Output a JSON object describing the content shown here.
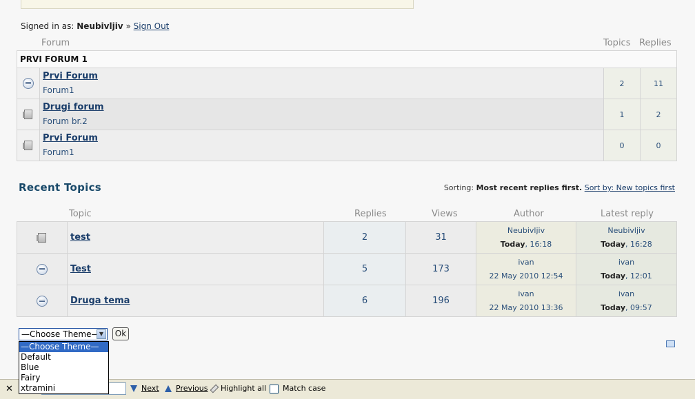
{
  "signin": {
    "prefix": "Signed in as:",
    "user": "Neubivljiv",
    "sep": "»",
    "signout": "Sign Out"
  },
  "forum_table": {
    "col_forum": "Forum",
    "col_topics": "Topics",
    "col_replies": "Replies",
    "category": "PRVI FORUM 1",
    "rows": [
      {
        "icon": "new-posts-icon",
        "title": "Prvi Forum",
        "desc": "Forum1",
        "topics": "2",
        "replies": "11"
      },
      {
        "icon": "folder-icon",
        "title": "Drugi forum",
        "desc": "Forum br.2",
        "topics": "1",
        "replies": "2"
      },
      {
        "icon": "folder-icon",
        "title": "Prvi Forum",
        "desc": "Forum1",
        "topics": "0",
        "replies": "0"
      }
    ]
  },
  "recent": {
    "title": "Recent Topics",
    "sorting_label": "Sorting:",
    "sorting_current": "Most recent replies first.",
    "sorting_link": "Sort by: New topics first",
    "cols": {
      "topic": "Topic",
      "replies": "Replies",
      "views": "Views",
      "author": "Author",
      "latest": "Latest reply"
    },
    "rows": [
      {
        "icon": "folder-icon",
        "topic": "test",
        "replies": "2",
        "views": "31",
        "author": "Neubivljiv",
        "author_date_bold": "Today",
        "author_date_rest": ", 16:18",
        "latest_user": "Neubivljiv",
        "latest_bold": "Today",
        "latest_rest": ", 16:28"
      },
      {
        "icon": "new-posts-icon",
        "topic": "Test",
        "replies": "5",
        "views": "173",
        "author": "ivan",
        "author_date_bold": "",
        "author_date_rest": "22 May 2010 12:54",
        "latest_user": "ivan",
        "latest_bold": "Today",
        "latest_rest": ", 12:01"
      },
      {
        "icon": "new-posts-icon",
        "topic": "Druga tema",
        "replies": "6",
        "views": "196",
        "author": "ivan",
        "author_date_bold": "",
        "author_date_rest": "22 May 2010 13:36",
        "latest_user": "ivan",
        "latest_bold": "Today",
        "latest_rest": ", 09:57"
      }
    ]
  },
  "theme": {
    "selected": "—Choose Theme—",
    "ok": "Ok",
    "options": [
      "—Choose Theme—",
      "Default",
      "Blue",
      "Fairy",
      "xtramini"
    ]
  },
  "findbar": {
    "close": "✕",
    "next": "Next",
    "previous": "Previous",
    "highlight": "Highlight all",
    "match_case": "Match case"
  }
}
